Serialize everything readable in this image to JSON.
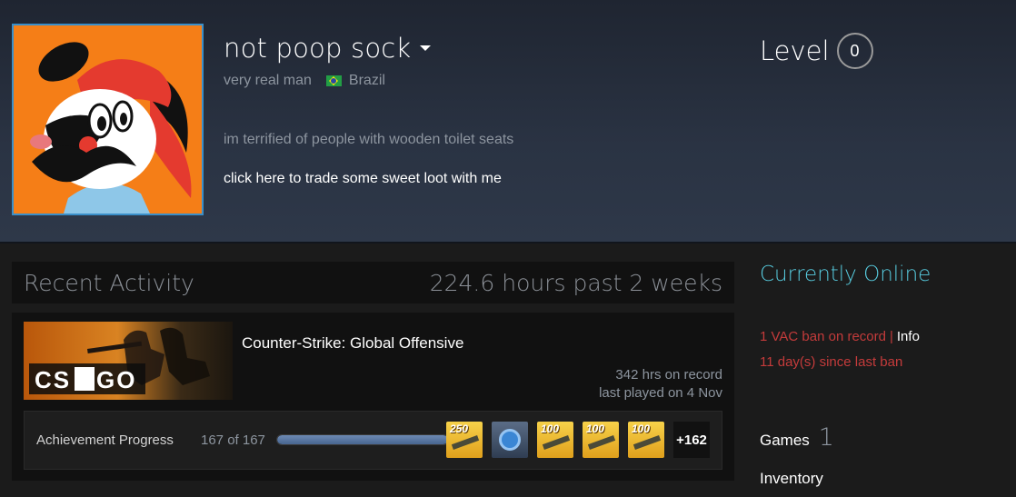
{
  "profile": {
    "persona_name": "not poop sock",
    "real_name": "very real man",
    "country": "Brazil",
    "summary": "im terrified of people with wooden toilet seats",
    "trade_link": "click here to trade some sweet loot with me",
    "level_label": "Level",
    "level_value": "0"
  },
  "activity": {
    "title": "Recent Activity",
    "hours_past": "224.6 hours past 2 weeks",
    "game": {
      "capsule_text": "CS:GO",
      "name": "Counter-Strike: Global Offensive",
      "hrs_on_record": "342 hrs on record",
      "last_played": "last played on 4 Nov",
      "achievements": {
        "label": "Achievement Progress",
        "count": "167 of 167",
        "progress": 1.0,
        "icons": [
          {
            "badge": "250",
            "icon": "rifle-icon"
          },
          {
            "badge": "",
            "icon": "medal-icon"
          },
          {
            "badge": "100",
            "icon": "grenade-icon"
          },
          {
            "badge": "100",
            "icon": "smg-icon"
          },
          {
            "badge": "100",
            "icon": "shotgun-icon"
          }
        ],
        "more": "+162"
      }
    }
  },
  "sidebar": {
    "status": "Currently Online",
    "vac_ban": "1 VAC ban on record",
    "vac_sep": "|",
    "vac_info": "Info",
    "days_since_ban": "11 day(s) since last ban",
    "games_label": "Games",
    "games_count": "1",
    "inventory_label": "Inventory"
  },
  "colors": {
    "online": "#57cbde",
    "vac": "#c43b3b",
    "avatar_bg": "#f57e17"
  }
}
